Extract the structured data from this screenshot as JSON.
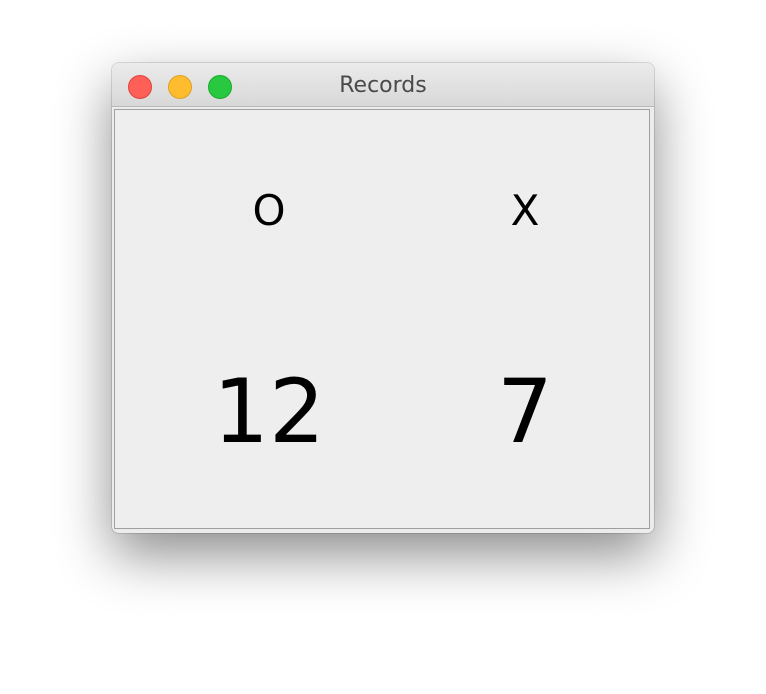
{
  "window": {
    "title": "Records"
  },
  "records": {
    "o_label": "O",
    "x_label": "X",
    "o_score": "12",
    "x_score": "7"
  },
  "colors": {
    "close": "#fe5f57",
    "minimize": "#febc2e",
    "zoom": "#28c840",
    "content_background": "#eeeeee",
    "text": "#000000"
  }
}
